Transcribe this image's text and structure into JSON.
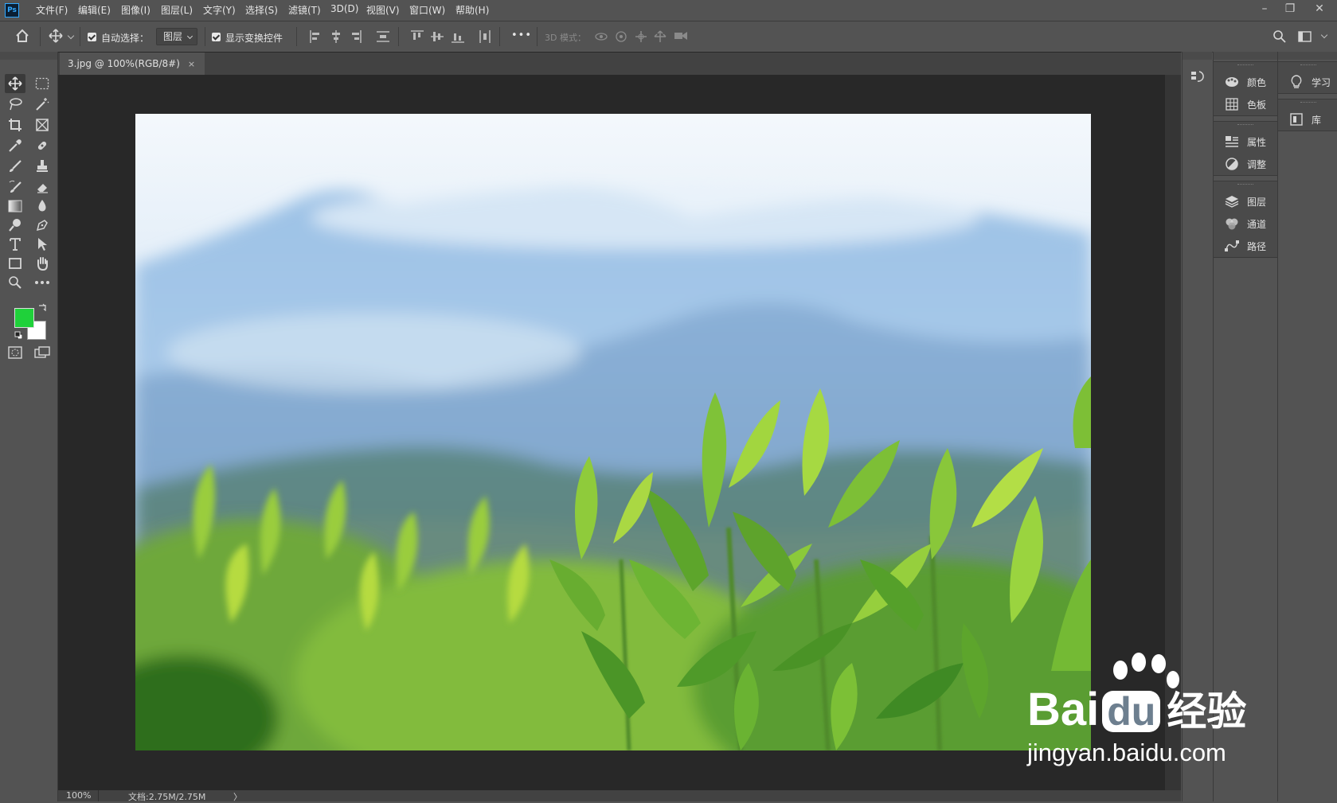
{
  "app": {
    "logo_text": "Ps"
  },
  "menu": [
    "文件(F)",
    "编辑(E)",
    "图像(I)",
    "图层(L)",
    "文字(Y)",
    "选择(S)",
    "滤镜(T)",
    "3D(D)",
    "视图(V)",
    "窗口(W)",
    "帮助(H)"
  ],
  "window_controls": {
    "minimize": "–",
    "restore": "❐",
    "close": "✕"
  },
  "options": {
    "auto_select_label": "自动选择：",
    "auto_select_target": "图层",
    "show_transform_label": "显示变换控件",
    "more_label": "•••",
    "mode_3d_label": "3D 模式："
  },
  "document_tab": {
    "title": "3.jpg @ 100%(RGB/8#)",
    "close": "×"
  },
  "status": {
    "zoom": "100%",
    "doc_info": "文档:2.75M/2.75M",
    "arrow": "〉"
  },
  "colors": {
    "foreground": "#1fd13a",
    "background": "#ffffff",
    "ui_bg": "#535353",
    "canvas_bg": "#282828"
  },
  "panels": {
    "group1": [
      {
        "icon": "palette-icon",
        "label": "颜色"
      },
      {
        "icon": "grid-icon",
        "label": "色板"
      }
    ],
    "group2": [
      {
        "icon": "properties-icon",
        "label": "属性"
      },
      {
        "icon": "adjust-icon",
        "label": "调整"
      }
    ],
    "group3": [
      {
        "icon": "layers-icon",
        "label": "图层"
      },
      {
        "icon": "channels-icon",
        "label": "通道"
      },
      {
        "icon": "paths-icon",
        "label": "路径"
      }
    ],
    "learn": {
      "icon": "bulb-icon",
      "label": "学习"
    },
    "library": {
      "icon": "library-icon",
      "label": "库"
    }
  },
  "watermark": {
    "brand": "Bai",
    "brand2": "du",
    "suffix": "经验",
    "url": "jingyan.baidu.com"
  }
}
